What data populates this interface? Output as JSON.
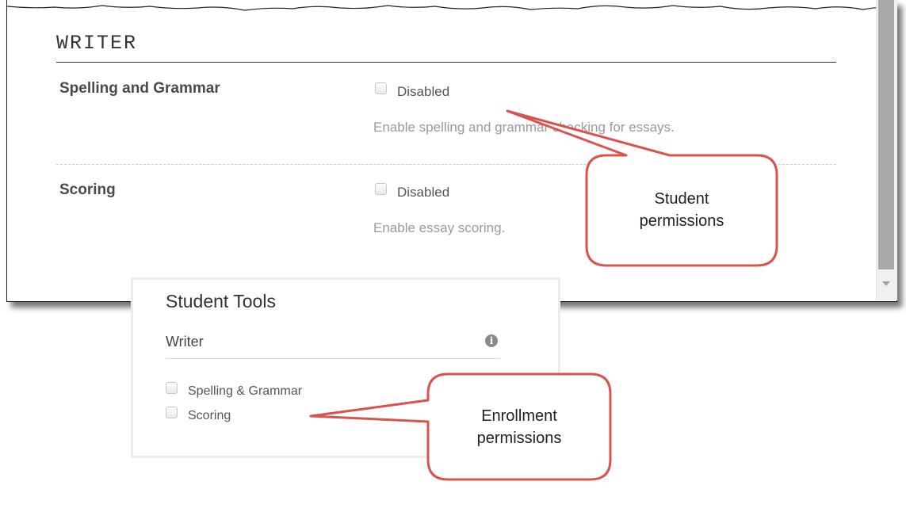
{
  "writer_panel": {
    "section_title": "WRITER",
    "settings": [
      {
        "label": "Spelling and Grammar",
        "checkbox_label": "Disabled",
        "help": "Enable spelling and grammar checking for essays."
      },
      {
        "label": "Scoring",
        "checkbox_label": "Disabled",
        "help": "Enable essay scoring."
      }
    ]
  },
  "student_tools": {
    "title": "Student Tools",
    "item": "Writer",
    "info_icon": "info-icon",
    "options": [
      "Spelling & Grammar",
      "Scoring"
    ]
  },
  "callouts": {
    "student": [
      "Student",
      "permissions"
    ],
    "enrollment": [
      "Enrollment",
      "permissions"
    ]
  },
  "colors": {
    "callout_border": "#d9534f",
    "rule": "#333333"
  }
}
